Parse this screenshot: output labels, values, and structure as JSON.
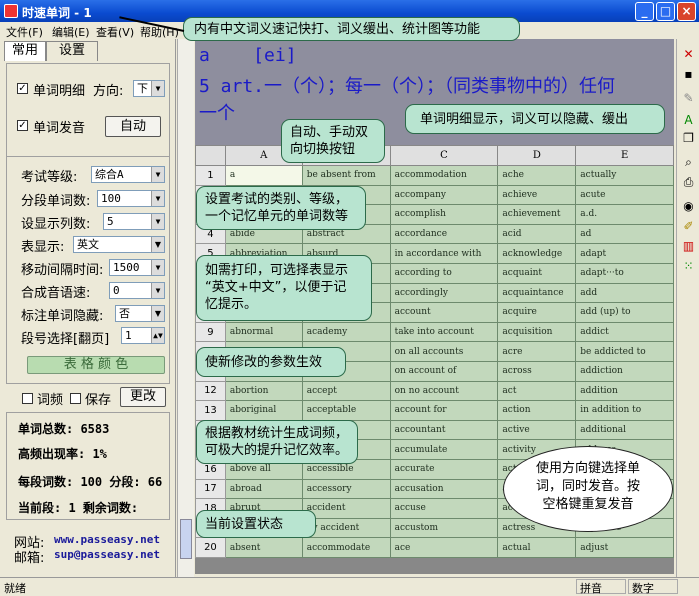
{
  "window": {
    "title": "时速单词 - 1",
    "btn_min": "_",
    "btn_max": "□",
    "btn_close": "×"
  },
  "menu": [
    "文件(F)",
    "编辑(E)",
    "查看(V)",
    "帮助(H)"
  ],
  "tabs": {
    "common": "常用",
    "settings": "设置"
  },
  "options": {
    "detail_label": "单词明细",
    "direction_label": "方向:",
    "direction_value": "下",
    "pron_label": "单词发音",
    "pron_button": "自动"
  },
  "settings": {
    "exam_level_label": "考试等级:",
    "exam_level_value": "综合A",
    "words_per_segment_label": "分段单词数:",
    "words_per_segment_value": "100",
    "columns_label": "设显示列数:",
    "columns_value": "5",
    "table_display_label": "表显示:",
    "table_display_value": "英文",
    "move_interval_label": "移动间隔时间:",
    "move_interval_value": "1500",
    "speech_rate_label": "合成音语速:",
    "speech_rate_value": "0",
    "hide_label": "标注单词隐藏:",
    "hide_value": "否",
    "page_label": "段号选择[翻页]",
    "page_value": "1",
    "table_color_button": "表 格 颜 色"
  },
  "freq": {
    "freq_label": "词频",
    "save_label": "保存",
    "change_button": "更改"
  },
  "stats": {
    "total": "单词总数: 6583",
    "high_freq": "高频出现率: 1%",
    "per_segment": "每段词数: 100 分段: 66",
    "current": "当前段: 1 剩余词数:"
  },
  "contact": {
    "site_label": "网站:",
    "site": "www.passeasy.net",
    "email_label": "邮箱:",
    "email": "sup@passeasy.net"
  },
  "word": {
    "line1": "a    [ei]",
    "line2": "5 art.一（个）；每一（个）；（同类事物中的）任何",
    "line3": "一个"
  },
  "grid": {
    "columns": [
      "",
      "A",
      "B",
      "C",
      "D",
      "E"
    ],
    "rows": [
      [
        "1",
        "a",
        "be absent from",
        "accommodation",
        "ache",
        "actually"
      ],
      [
        "2",
        "abandon",
        "",
        "accompany",
        "achieve",
        "acute"
      ],
      [
        "3",
        "abdomen",
        "",
        "accomplish",
        "achievement",
        "a.d."
      ],
      [
        "4",
        "abide",
        "abstract",
        "accordance",
        "acid",
        "ad"
      ],
      [
        "5",
        "abbreviation",
        "absurd",
        "in accordance with",
        "acknowledge",
        "adapt"
      ],
      [
        "6",
        "",
        "",
        "according to",
        "acquaint",
        "adapt···to"
      ],
      [
        "7",
        "",
        "",
        "accordingly",
        "acquaintance",
        "add"
      ],
      [
        "8",
        "",
        "academic",
        "account",
        "acquire",
        "add (up) to"
      ],
      [
        "9",
        "abnormal",
        "academy",
        "take into account",
        "acquisition",
        "addict"
      ],
      [
        "10",
        "",
        "",
        "on all accounts",
        "acre",
        "be addicted to"
      ],
      [
        "11",
        "",
        "",
        "on account of",
        "across",
        "addiction"
      ],
      [
        "12",
        "abortion",
        "accept",
        "on no account",
        "act",
        "addition"
      ],
      [
        "13",
        "aboriginal",
        "acceptable",
        "account for",
        "action",
        "in addition to"
      ],
      [
        "14",
        "",
        "",
        "accountant",
        "active",
        "additional"
      ],
      [
        "15",
        "",
        "",
        "accumulate",
        "activity",
        "address"
      ],
      [
        "16",
        "above all",
        "accessible",
        "accurate",
        "actor",
        "adequate"
      ],
      [
        "17",
        "abroad",
        "accessory",
        "accusation",
        "actress",
        "adhere"
      ],
      [
        "18",
        "abrupt",
        "accident",
        "accuse",
        "actual",
        "adjacent"
      ],
      [
        "19",
        "absence",
        "by accident",
        "accustom",
        "actress",
        "adjective"
      ],
      [
        "20",
        "absent",
        "accommodate",
        "ace",
        "actual",
        "adjust"
      ]
    ]
  },
  "statusbar": {
    "ready": "就绪",
    "pinyin": "拼音",
    "numeric": "数字"
  },
  "callouts": {
    "c1": "内有中文词义速记快打、词义缓出、统计图等功能",
    "c2": "单词明细显示，词义可以隐藏、缓出",
    "c3": "自动、手动双\n向切换按钮",
    "c4": "设置考试的类别、等级，\n一个记忆单元的单词数等",
    "c5": "如需打印，可选择表显示\n“英文+中文”，以便于记\n忆提示。",
    "c6": "使新修改的参数生效",
    "c7": "根据教材统计生成词频，\n可极大的提升记忆效率。",
    "c8": "当前设置状态",
    "cloud": "使用方向键选择单\n词，同时发音。按\n空格键重复发音"
  },
  "colors": {
    "title": "#0a4bd0",
    "grid_cell": "#c2d8bc",
    "word_panel": "#8e8e9e",
    "word_text": "#1a1ac8",
    "callout": "#b8e4d0"
  }
}
